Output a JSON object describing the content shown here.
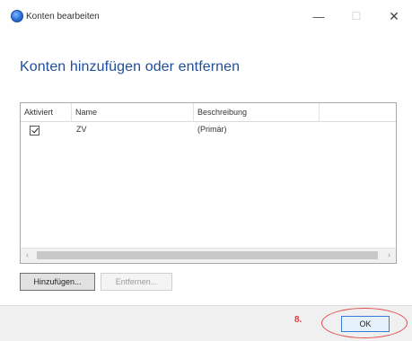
{
  "window": {
    "title": "Konten bearbeiten",
    "icon": "globe-icon",
    "minimize_glyph": "—",
    "maximize_glyph": "☐",
    "close_glyph": "✕"
  },
  "heading": "Konten hinzufügen oder entfernen",
  "list": {
    "columns": [
      "Aktiviert",
      "Name",
      "Beschreibung"
    ],
    "rows": [
      {
        "checked": true,
        "name": "ZV",
        "description": "(Primär)"
      }
    ],
    "scroll_left": "‹",
    "scroll_right": "›"
  },
  "buttons": {
    "add": "Hinzufügen...",
    "remove": "Entfernen..."
  },
  "footer": {
    "annotation": "8.",
    "ok": "OK"
  },
  "colors": {
    "heading": "#1f4e9a",
    "annotation": "#e03a3a",
    "ok_border": "#3a7bd5"
  }
}
